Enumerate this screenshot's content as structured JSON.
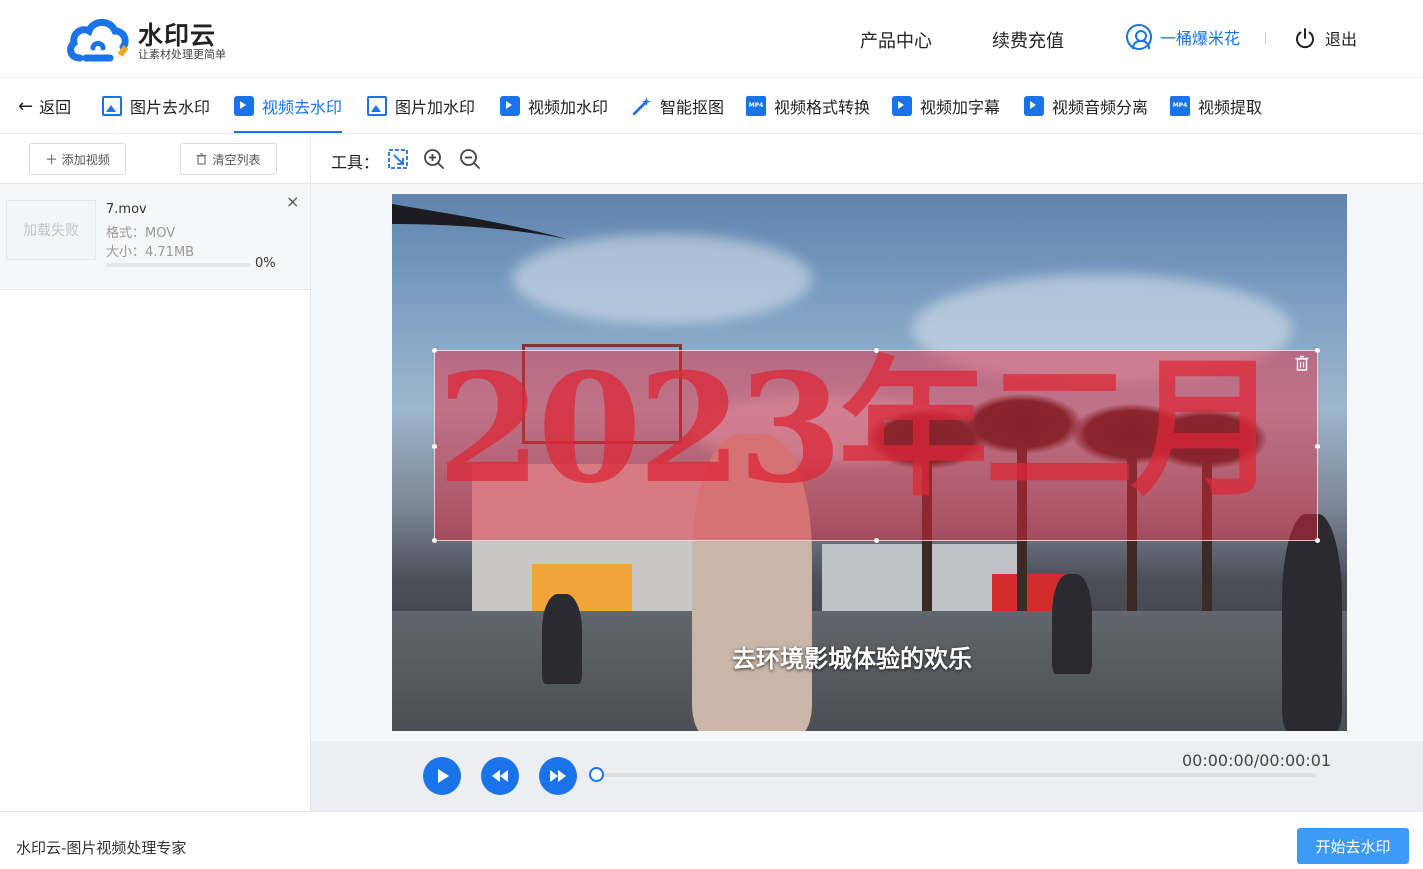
{
  "app": {
    "name": "水印云",
    "slogan": "让素材处理更简单"
  },
  "header": {
    "nav_products": "产品中心",
    "nav_recharge": "续费充值",
    "username": "一桶爆米花",
    "logout": "退出"
  },
  "tabs": [
    {
      "label": "返回",
      "icon": "back-arrow-icon"
    },
    {
      "label": "图片去水印",
      "icon": "image-icon"
    },
    {
      "label": "视频去水印",
      "icon": "video-icon",
      "active": true
    },
    {
      "label": "图片加水印",
      "icon": "image-icon"
    },
    {
      "label": "视频加水印",
      "icon": "video-icon"
    },
    {
      "label": "智能抠图",
      "icon": "magic-wand-icon"
    },
    {
      "label": "视频格式转换",
      "icon": "mp4-icon"
    },
    {
      "label": "视频加字幕",
      "icon": "video-icon"
    },
    {
      "label": "视频音频分离",
      "icon": "video-icon"
    },
    {
      "label": "视频提取",
      "icon": "mp4-icon"
    }
  ],
  "sidebar": {
    "add_video": "添加视频",
    "clear_list": "清空列表",
    "file": {
      "thumb_status": "加载失败",
      "name": "7.mov",
      "format": "格式：MOV",
      "size": "大小：4.71MB",
      "progress_percent": 0,
      "progress_text": "0%"
    }
  },
  "tools": {
    "label": "工具："
  },
  "video": {
    "watermark_text": "2023年二月",
    "subtitle": "去环境影城体验的欢乐"
  },
  "player": {
    "time": "00:00:00/00:00:01",
    "progress": 0
  },
  "footer": {
    "text": "水印云-图片视频处理专家",
    "start_button": "开始去水印"
  },
  "colors": {
    "accent": "#1a73e8",
    "start_button": "#3d9bf5",
    "selection": "#e6283c"
  }
}
